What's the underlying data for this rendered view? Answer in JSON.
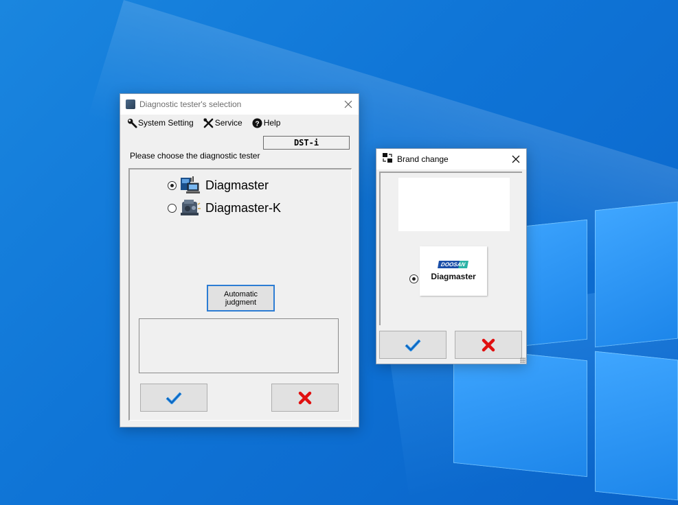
{
  "window1": {
    "title": "Diagnostic tester's selection",
    "menu": {
      "system_setting": "System Setting",
      "service": "Service",
      "help": "Help"
    },
    "tester_field": "DST-i",
    "prompt": "Please choose the diagnostic tester",
    "options": [
      {
        "label": "Diagmaster",
        "selected": true
      },
      {
        "label": "Diagmaster-K",
        "selected": false
      }
    ],
    "auto_button": {
      "line1": "Automatic",
      "line2": "judgment"
    },
    "message": ""
  },
  "window2": {
    "title": "Brand change",
    "brand_logo": {
      "brand_mark": "DOOSAN",
      "product": "Diagmaster"
    },
    "brand_selected": true
  },
  "colors": {
    "ok_check": "#1e88e5",
    "cancel_x": "#e01010",
    "focus_border": "#2b7cd3",
    "desktop": "#0f74d6"
  },
  "icons": {
    "ok": "check-icon",
    "cancel": "x-icon"
  }
}
